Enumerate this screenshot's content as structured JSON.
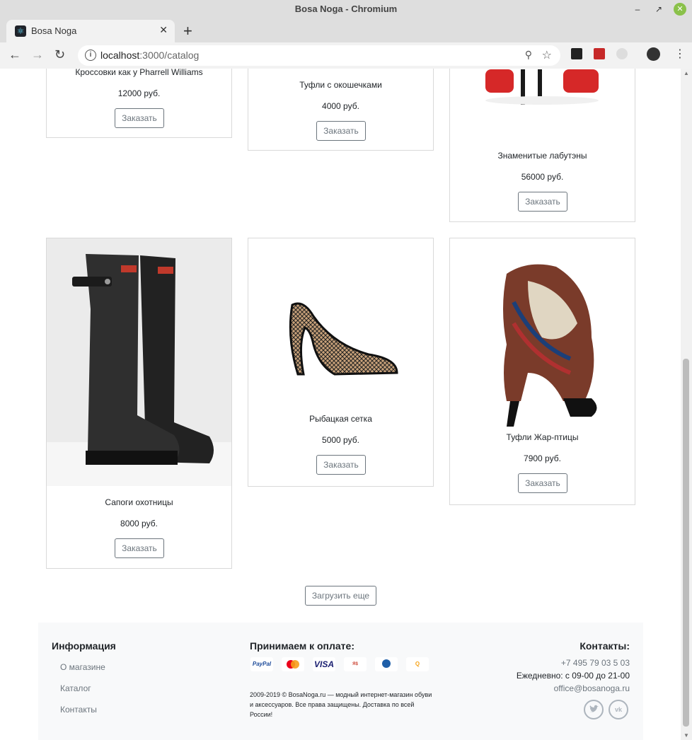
{
  "window": {
    "title": "Bosa Noga - Chromium"
  },
  "tab": {
    "title": "Bosa Noga"
  },
  "address": {
    "host": "localhost",
    "path": ":3000/catalog"
  },
  "products_top": [
    {
      "name": "Кроссовки как у Pharrell Williams",
      "price": "12000 руб.",
      "button": "Заказать"
    },
    {
      "name": "Туфли с окошечками",
      "price": "4000 руб.",
      "button": "Заказать"
    },
    {
      "name": "Знаменитые лабутэны",
      "price": "56000 руб.",
      "button": "Заказать"
    }
  ],
  "products_bottom": [
    {
      "name": "Сапоги охотницы",
      "price": "8000 руб.",
      "button": "Заказать"
    },
    {
      "name": "Рыбацкая сетка",
      "price": "5000 руб.",
      "button": "Заказать"
    },
    {
      "name": "Туфли Жар-птицы",
      "price": "7900 руб.",
      "button": "Заказать"
    }
  ],
  "load_more": "Загрузить еще",
  "footer": {
    "info_title": "Информация",
    "links": [
      "О магазине",
      "Каталог",
      "Контакты"
    ],
    "payment_title": "Принимаем к оплате:",
    "payment_methods": [
      "PayPal",
      "MasterCard",
      "VISA",
      "Яндекс Деньги",
      "WebMoney",
      "QIWI"
    ],
    "copyright": "2009-2019 © BosaNoga.ru — модный интернет-магазин обуви и аксессуаров. Все права защищены. Доставка по всей России!",
    "contacts_title": "Контакты:",
    "phone": "+7 495 79 03 5 03",
    "hours": "Ежедневно: с 09-00 до 21-00",
    "email": "office@bosanoga.ru",
    "social": [
      "twitter-icon",
      "vk-icon"
    ]
  }
}
